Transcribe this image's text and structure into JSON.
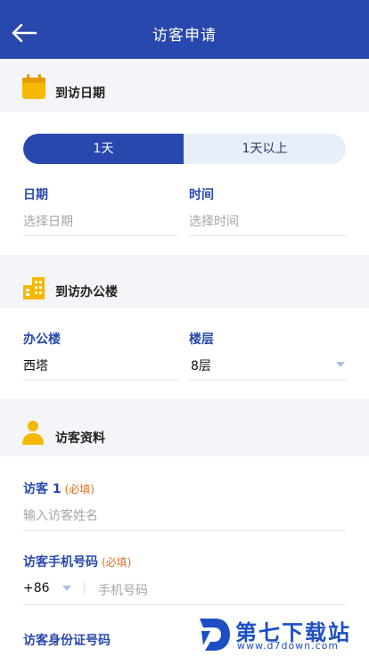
{
  "header": {
    "title": "访客申请"
  },
  "sections": {
    "date": {
      "title": "到访日期"
    },
    "building": {
      "title": "到访办公楼"
    },
    "visitor": {
      "title": "访客资料"
    }
  },
  "segment": {
    "option1": "1天",
    "option2": "1天以上",
    "selected": "1天"
  },
  "date_fields": {
    "date_label": "日期",
    "date_placeholder": "选择日期",
    "time_label": "时间",
    "time_placeholder": "选择时间"
  },
  "building_fields": {
    "building_label": "办公楼",
    "building_value": "西塔",
    "floor_label": "楼层",
    "floor_value": "8层"
  },
  "visitor_fields": {
    "visitor_label": "访客 1",
    "required": "(必填)",
    "name_placeholder": "输入访客姓名",
    "phone_label": "访客手机号码",
    "country_code": "+86",
    "phone_placeholder": "手机号码",
    "id_label": "访客身份证号码"
  },
  "watermark": {
    "title": "第七下载站",
    "url": "www.d7down.com"
  },
  "colors": {
    "primary": "#2948ad",
    "accent_yellow": "#f5b800",
    "required": "#e07024"
  }
}
